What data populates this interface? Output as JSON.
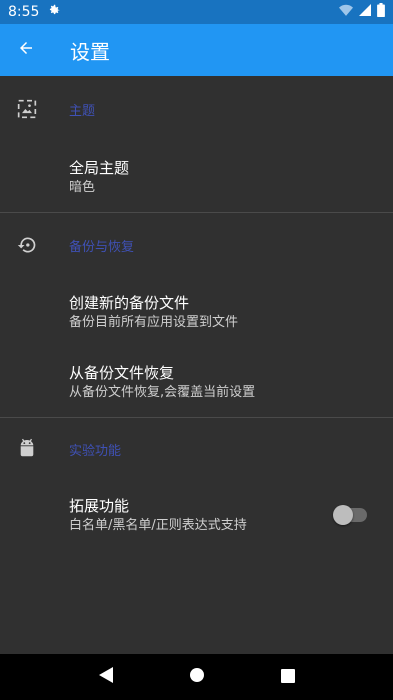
{
  "status_bar": {
    "time": "8:55",
    "icons": [
      "gear-icon",
      "wifi-icon",
      "signal-icon",
      "battery-icon"
    ]
  },
  "toolbar": {
    "title": "设置",
    "back_icon": "arrow-left-icon"
  },
  "sections": [
    {
      "title": "主题",
      "icon": "image-icon",
      "items": [
        {
          "title": "全局主题",
          "summary": "暗色"
        }
      ]
    },
    {
      "title": "备份与恢复",
      "icon": "restore-icon",
      "items": [
        {
          "title": "创建新的备份文件",
          "summary": "备份目前所有应用设置到文件"
        },
        {
          "title": "从备份文件恢复",
          "summary": "从备份文件恢复,会覆盖当前设置"
        }
      ]
    },
    {
      "title": "实验功能",
      "icon": "android-icon",
      "items": [
        {
          "title": "拓展功能",
          "summary": "白名单/黑名单/正则表达式支持",
          "switch": false
        }
      ]
    }
  ],
  "nav_bar": {
    "buttons": [
      "back-triangle-icon",
      "home-circle-icon",
      "recents-square-icon"
    ]
  },
  "colors": {
    "status_bar": "#1873c0",
    "toolbar": "#2196f3",
    "background": "#303030",
    "section_title": "#3f51b5"
  }
}
